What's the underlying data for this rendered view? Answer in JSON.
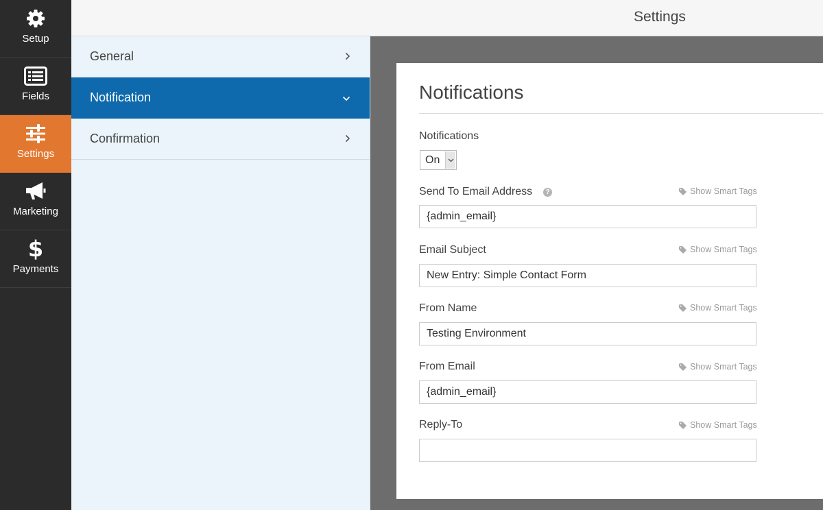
{
  "sidebar": {
    "items": [
      {
        "label": "Setup",
        "icon": "gear-icon"
      },
      {
        "label": "Fields",
        "icon": "list-icon"
      },
      {
        "label": "Settings",
        "icon": "sliders-icon",
        "active": true
      },
      {
        "label": "Marketing",
        "icon": "megaphone-icon"
      },
      {
        "label": "Payments",
        "icon": "dollar-icon"
      }
    ]
  },
  "header": {
    "title": "Settings"
  },
  "subnav": {
    "items": [
      {
        "label": "General",
        "chevron": "›"
      },
      {
        "label": "Notification",
        "chevron": "⌄",
        "active": true
      },
      {
        "label": "Confirmation",
        "chevron": "›"
      }
    ]
  },
  "panel": {
    "title": "Notifications",
    "notifications_label": "Notifications",
    "notifications_value": "On",
    "smart_tags_label": "Show Smart Tags",
    "help_glyph": "?",
    "fields": [
      {
        "label": "Send To Email Address",
        "value": "{admin_email}"
      },
      {
        "label": "Email Subject",
        "value": "New Entry: Simple Contact Form"
      },
      {
        "label": "From Name",
        "value": "Testing Environment"
      },
      {
        "label": "From Email",
        "value": "{admin_email}"
      },
      {
        "label": "Reply-To",
        "value": ""
      }
    ]
  },
  "colors": {
    "sidebar_bg": "#2b2b2b",
    "active_orange": "#e27730",
    "active_blue": "#0e6aac",
    "subpanel_bg": "#eaf4fa",
    "content_bg": "#6d6d6d"
  }
}
